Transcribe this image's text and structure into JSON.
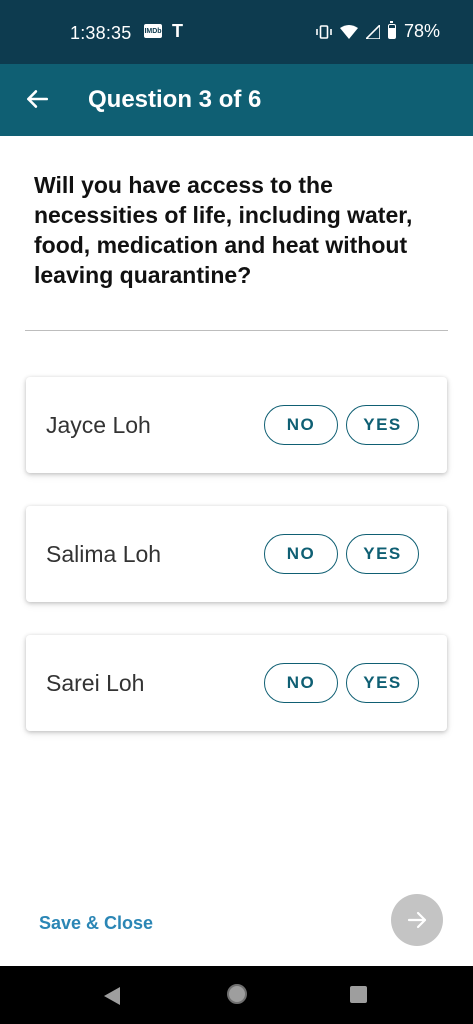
{
  "status_bar": {
    "time": "1:38:35",
    "battery": "78%",
    "icons": [
      "imdb-icon",
      "tesla-icon",
      "vibrate-icon",
      "wifi-icon",
      "signal-icon",
      "battery-icon"
    ],
    "imdb_text": "IMDb"
  },
  "app_bar": {
    "title": "Question 3 of 6",
    "back_icon": "arrow-left-icon"
  },
  "question": "Will you have access to the necessities of life, including water, food, medication and heat without leaving quarantine?",
  "people": [
    {
      "name": "Jayce Loh",
      "no_label": "NO",
      "yes_label": "YES"
    },
    {
      "name": "Salima Loh",
      "no_label": "NO",
      "yes_label": "YES"
    },
    {
      "name": "Sarei Loh",
      "no_label": "NO",
      "yes_label": "YES"
    }
  ],
  "footer": {
    "save_close": "Save & Close",
    "next_icon": "arrow-right-icon"
  },
  "colors": {
    "status_bar_bg": "#0d3b4f",
    "app_bar_bg": "#0f5f73",
    "accent": "#0f5f73",
    "link": "#2b86b5",
    "fab_disabled": "#c4c4c4"
  }
}
